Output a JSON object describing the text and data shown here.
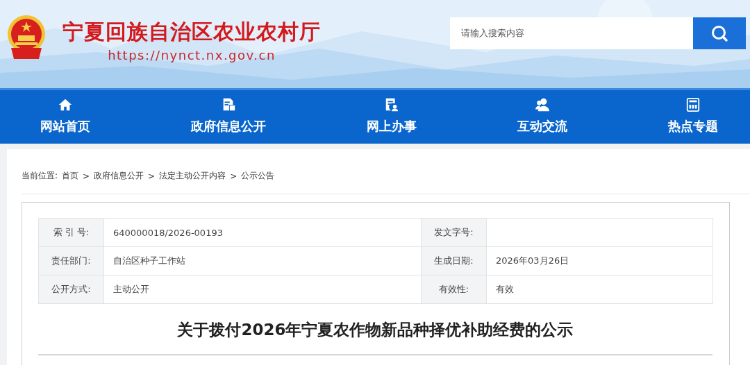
{
  "site": {
    "title": "宁夏回族自治区农业农村厅",
    "url": "https://nynct.nx.gov.cn"
  },
  "search": {
    "placeholder": "请输入搜索内容"
  },
  "nav": [
    {
      "label": "网站首页",
      "kind": "home"
    },
    {
      "label": "政府信息公开",
      "kind": "docs"
    },
    {
      "label": "网上办事",
      "kind": "service"
    },
    {
      "label": "互动交流",
      "kind": "people"
    },
    {
      "label": "热点专题",
      "kind": "screen"
    }
  ],
  "breadcrumb": {
    "prefix": "当前位置:",
    "separator": ">",
    "items": [
      "首页",
      "政府信息公开",
      "法定主动公开内容",
      "公示公告"
    ]
  },
  "info_table": [
    {
      "cells": [
        {
          "label": "索 引 号:",
          "value": "640000018/2026-00193"
        },
        {
          "label": "发文字号:"
        }
      ]
    },
    {
      "cells": [
        {
          "label": "责任部门:",
          "value": "自治区种子工作站"
        },
        {
          "label": "生成日期:",
          "value": "2026年03月26日"
        }
      ]
    },
    {
      "cells": [
        {
          "label": "公开方式:",
          "value": "主动公开"
        },
        {
          "label": "有效性:",
          "value": "有效"
        }
      ]
    }
  ],
  "article": {
    "title": "关于拨付2026年宁夏农作物新品种择优补助经费的公示"
  }
}
